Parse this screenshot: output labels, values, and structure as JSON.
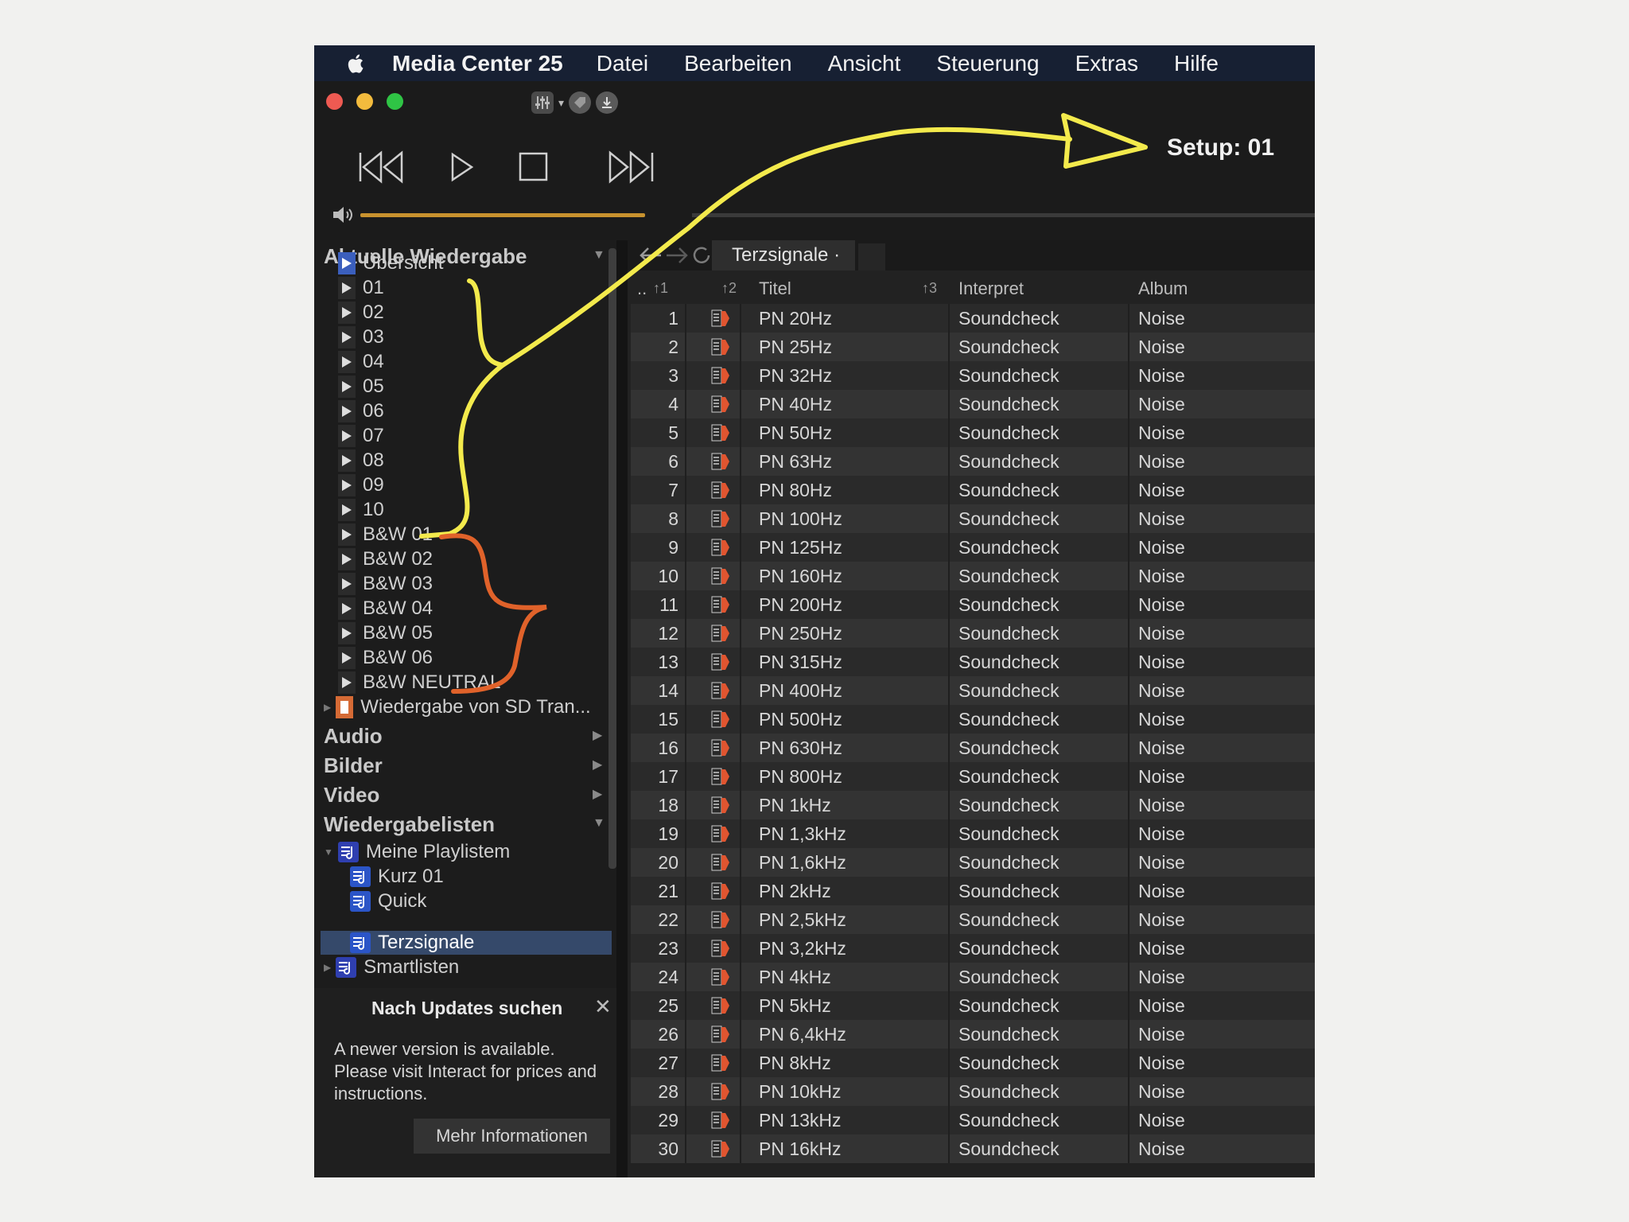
{
  "menubar": {
    "app_name": "Media Center 25",
    "items": [
      "Datei",
      "Bearbeiten",
      "Ansicht",
      "Steuerung",
      "Extras",
      "Hilfe"
    ]
  },
  "setup_label": "Setup: 01",
  "colors": {
    "accent": "#c8922e",
    "selection": "#35496a",
    "annotation_yellow": "#f3ea4c",
    "annotation_orange": "#e0622a"
  },
  "volume_level": 1.0,
  "sidebar": {
    "current_section": "Aktuelle Wiedergabe",
    "current_items": [
      "Übersicht",
      "01",
      "02",
      "03",
      "04",
      "05",
      "06",
      "07",
      "08",
      "09",
      "10",
      "B&W 01",
      "B&W 02",
      "B&W 03",
      "B&W 04",
      "B&W 05",
      "B&W 06",
      "B&W NEUTRAL",
      "Wiedergabe von SD Tran..."
    ],
    "audio": "Audio",
    "bilder": "Bilder",
    "video": "Video",
    "playlists_section": "Wiedergabelisten",
    "my_playlists": "Meine Playlistem",
    "playlists": [
      "Kurz 01",
      "Quick",
      "Terzsignale"
    ],
    "smartlists": "Smartlisten"
  },
  "update": {
    "title": "Nach Updates suchen",
    "close": "✕",
    "text": "A newer version is available. Please visit Interact for prices and instructions.",
    "button": "Mehr Informationen"
  },
  "main": {
    "tab": "Terzsignale ·",
    "headers": {
      "dots": "..",
      "sort1": "↑1",
      "sort2": "↑2",
      "title": "Titel",
      "sort3": "↑3",
      "artist": "Interpret",
      "album": "Album"
    },
    "rows": [
      {
        "n": "1",
        "t": "PN 20Hz",
        "a": "Soundcheck",
        "al": "Noise"
      },
      {
        "n": "2",
        "t": "PN 25Hz",
        "a": "Soundcheck",
        "al": "Noise"
      },
      {
        "n": "3",
        "t": "PN 32Hz",
        "a": "Soundcheck",
        "al": "Noise"
      },
      {
        "n": "4",
        "t": "PN 40Hz",
        "a": "Soundcheck",
        "al": "Noise"
      },
      {
        "n": "5",
        "t": "PN 50Hz",
        "a": "Soundcheck",
        "al": "Noise"
      },
      {
        "n": "6",
        "t": "PN 63Hz",
        "a": "Soundcheck",
        "al": "Noise"
      },
      {
        "n": "7",
        "t": "PN 80Hz",
        "a": "Soundcheck",
        "al": "Noise"
      },
      {
        "n": "8",
        "t": "PN 100Hz",
        "a": "Soundcheck",
        "al": "Noise"
      },
      {
        "n": "9",
        "t": "PN 125Hz",
        "a": "Soundcheck",
        "al": "Noise"
      },
      {
        "n": "10",
        "t": "PN 160Hz",
        "a": "Soundcheck",
        "al": "Noise"
      },
      {
        "n": "11",
        "t": "PN 200Hz",
        "a": "Soundcheck",
        "al": "Noise"
      },
      {
        "n": "12",
        "t": "PN 250Hz",
        "a": "Soundcheck",
        "al": "Noise"
      },
      {
        "n": "13",
        "t": "PN 315Hz",
        "a": "Soundcheck",
        "al": "Noise"
      },
      {
        "n": "14",
        "t": "PN 400Hz",
        "a": "Soundcheck",
        "al": "Noise"
      },
      {
        "n": "15",
        "t": "PN 500Hz",
        "a": "Soundcheck",
        "al": "Noise"
      },
      {
        "n": "16",
        "t": "PN 630Hz",
        "a": "Soundcheck",
        "al": "Noise"
      },
      {
        "n": "17",
        "t": "PN 800Hz",
        "a": "Soundcheck",
        "al": "Noise"
      },
      {
        "n": "18",
        "t": "PN 1kHz",
        "a": "Soundcheck",
        "al": "Noise"
      },
      {
        "n": "19",
        "t": "PN 1,3kHz",
        "a": "Soundcheck",
        "al": "Noise"
      },
      {
        "n": "20",
        "t": "PN 1,6kHz",
        "a": "Soundcheck",
        "al": "Noise"
      },
      {
        "n": "21",
        "t": "PN 2kHz",
        "a": "Soundcheck",
        "al": "Noise"
      },
      {
        "n": "22",
        "t": "PN 2,5kHz",
        "a": "Soundcheck",
        "al": "Noise"
      },
      {
        "n": "23",
        "t": "PN 3,2kHz",
        "a": "Soundcheck",
        "al": "Noise"
      },
      {
        "n": "24",
        "t": "PN 4kHz",
        "a": "Soundcheck",
        "al": "Noise"
      },
      {
        "n": "25",
        "t": "PN 5kHz",
        "a": "Soundcheck",
        "al": "Noise"
      },
      {
        "n": "26",
        "t": "PN 6,4kHz",
        "a": "Soundcheck",
        "al": "Noise"
      },
      {
        "n": "27",
        "t": "PN 8kHz",
        "a": "Soundcheck",
        "al": "Noise"
      },
      {
        "n": "28",
        "t": "PN 10kHz",
        "a": "Soundcheck",
        "al": "Noise"
      },
      {
        "n": "29",
        "t": "PN 13kHz",
        "a": "Soundcheck",
        "al": "Noise"
      },
      {
        "n": "30",
        "t": "PN 16kHz",
        "a": "Soundcheck",
        "al": "Noise"
      }
    ]
  }
}
